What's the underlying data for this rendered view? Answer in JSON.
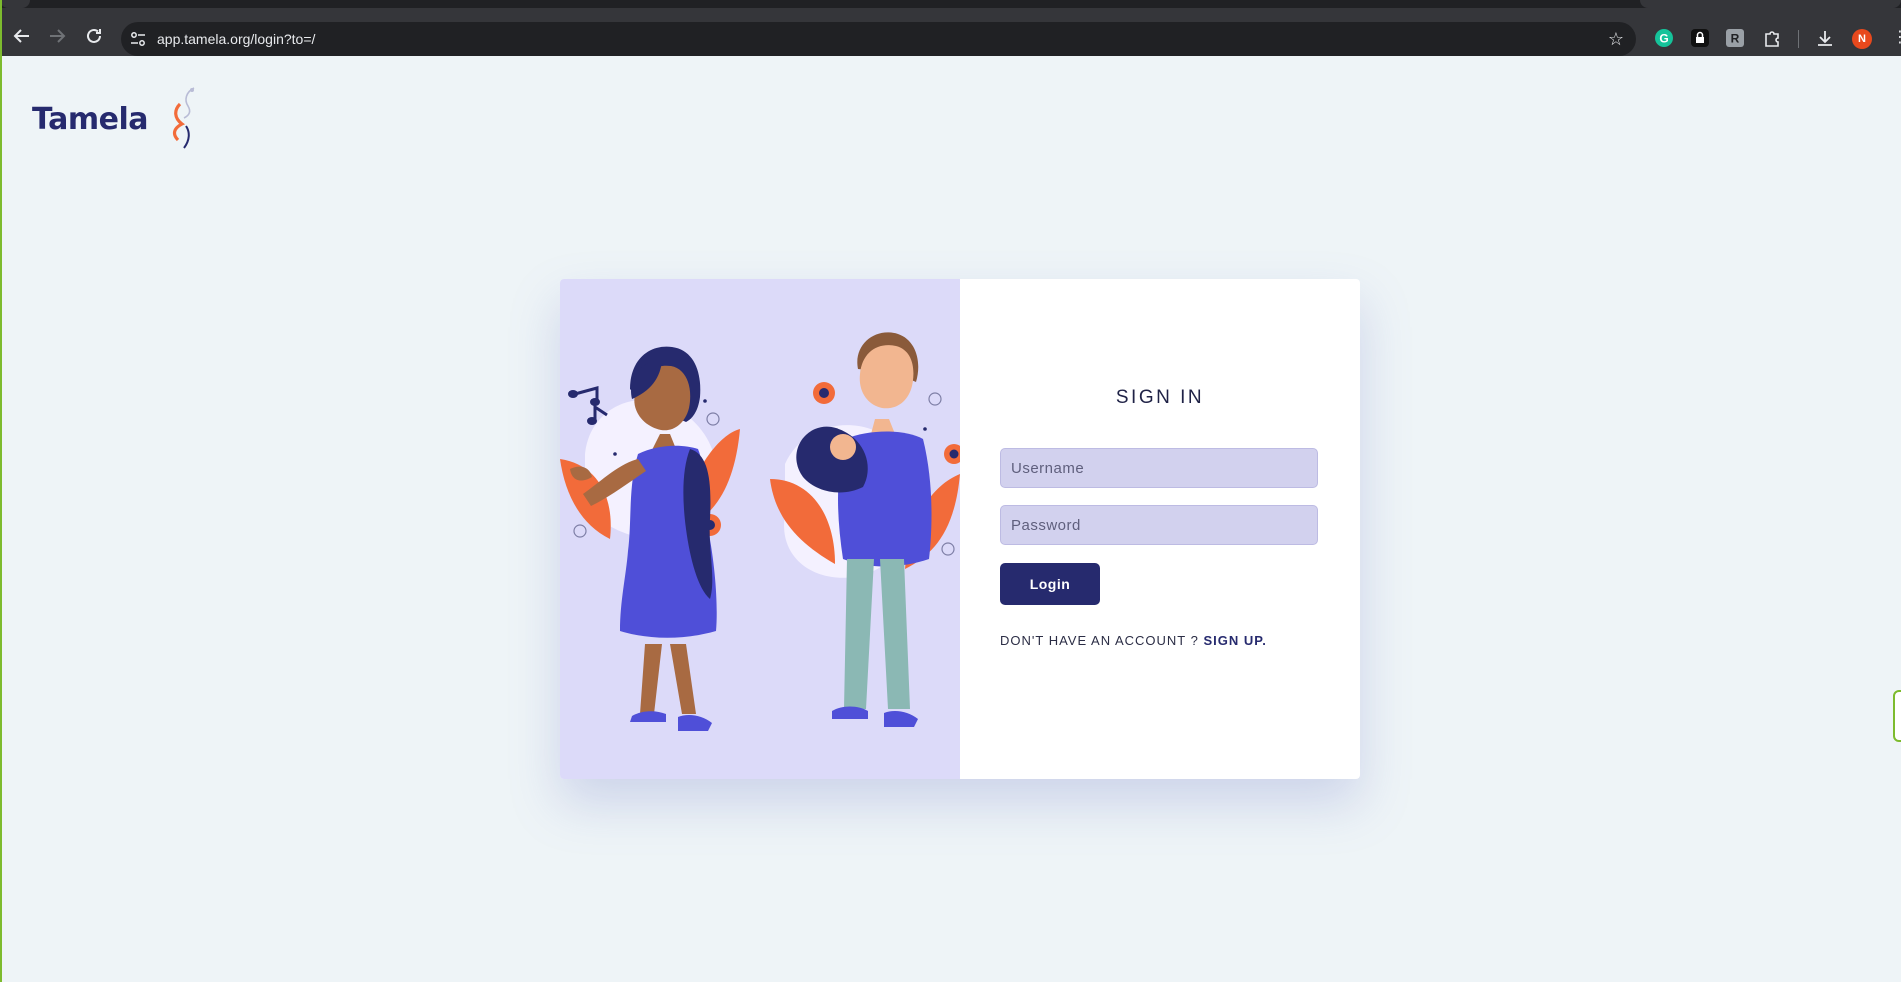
{
  "browser": {
    "url": "app.tamela.org/login?to=/",
    "profile_initial": "N",
    "extensions": [
      "grammarly-icon",
      "lock-extension-icon",
      "r-extension-icon",
      "puzzle-icon"
    ]
  },
  "brand": {
    "logo_text": "Tamela"
  },
  "login": {
    "title": "SIGN IN",
    "username_placeholder": "Username",
    "password_placeholder": "Password",
    "login_label": "Login",
    "no_account_text": "DON'T HAVE AN ACCOUNT ?",
    "signup_label": "SIGN UP."
  },
  "colors": {
    "brand_navy": "#262a6e",
    "illustration_bg": "#dcdaf9",
    "input_bg": "#d2d1ee",
    "page_bg": "#eef4f7",
    "accent_orange": "#f26b3a"
  }
}
